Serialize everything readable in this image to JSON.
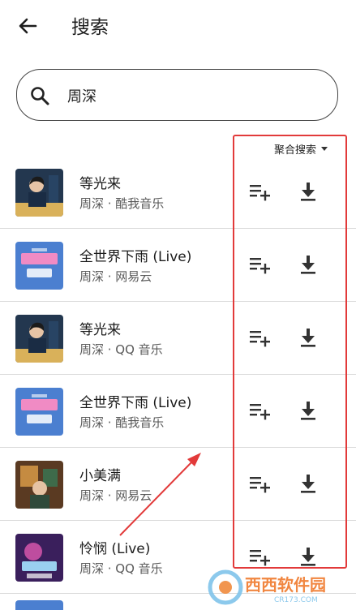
{
  "header": {
    "title": "搜索"
  },
  "search": {
    "query": "周深"
  },
  "filter": {
    "label": "聚合搜索"
  },
  "songs": [
    {
      "title": "等光来",
      "subtitle": "周深 · 酷我音乐"
    },
    {
      "title": "全世界下雨 (Live)",
      "subtitle": "周深 · 网易云"
    },
    {
      "title": "等光来",
      "subtitle": "周深 · QQ 音乐"
    },
    {
      "title": "全世界下雨 (Live)",
      "subtitle": "周深 · 酷我音乐"
    },
    {
      "title": "小美满",
      "subtitle": "周深 · 网易云"
    },
    {
      "title": "怜悯 (Live)",
      "subtitle": "周深 · QQ 音乐"
    }
  ],
  "annotation": {
    "color": "#e23a3a"
  },
  "watermark": {
    "text": "西西软件园",
    "url": "CR173.COM"
  },
  "icons": {
    "back": "arrow-back-icon",
    "search": "search-icon",
    "add": "playlist-add-icon",
    "download": "download-icon"
  }
}
